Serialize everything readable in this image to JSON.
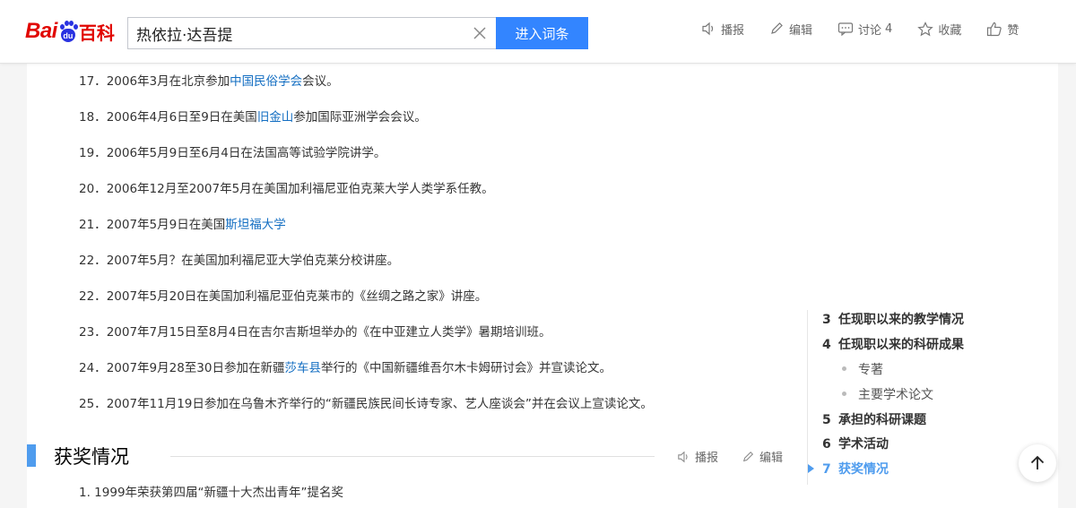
{
  "header": {
    "logo_bai": "Bai",
    "logo_du": "du",
    "logo_baike": "百科",
    "search_value": "热依拉·达吾提",
    "search_button": "进入词条",
    "tools": [
      {
        "label": "播报",
        "icon": "speaker-icon"
      },
      {
        "label": "编辑",
        "icon": "pencil-icon"
      },
      {
        "label": "讨论",
        "icon": "comment-icon",
        "count": "4"
      },
      {
        "label": "收藏",
        "icon": "star-icon"
      },
      {
        "label": "赞",
        "icon": "thumbs-up-icon"
      }
    ]
  },
  "activities": [
    {
      "num": "17．",
      "before": "2006年3月在北京参加",
      "link": "中国民俗学会",
      "after": "会议。"
    },
    {
      "num": "18．",
      "before": "2006年4月6日至9日在美国",
      "link": "旧金山",
      "after": "参加国际亚洲学会会议。"
    },
    {
      "num": "19．",
      "before": "2006年5月9日至6月4日在法国高等试验学院讲学。",
      "link": "",
      "after": ""
    },
    {
      "num": "20．",
      "before": "2006年12月至2007年5月在美国加利福尼亚伯克莱大学人类学系任教。",
      "link": "",
      "after": ""
    },
    {
      "num": "21．",
      "before": "2007年5月9日在美国",
      "link": "斯坦福大学",
      "after": ""
    },
    {
      "num": "22．",
      "before": "2007年5月？在美国加利福尼亚大学伯克莱分校讲座。",
      "link": "",
      "after": ""
    },
    {
      "num": "22．",
      "before": "2007年5月20日在美国加利福尼亚伯克莱市的《丝绸之路之家》讲座。",
      "link": "",
      "after": ""
    },
    {
      "num": "23．",
      "before": "2007年7月15日至8月4日在吉尔吉斯坦举办的《在中亚建立人类学》暑期培训班。",
      "link": "",
      "after": ""
    },
    {
      "num": "24．",
      "before": "2007年9月28至30日参加在新疆",
      "link": "莎车县",
      "after": "举行的《中国新疆维吾尔木卡姆研讨会》并宣读论文。"
    },
    {
      "num": "25．",
      "before": "2007年11月19日参加在乌鲁木齐举行的“新疆民族民间长诗专家、艺人座谈会”并在会议上宣读论文。",
      "link": "",
      "after": ""
    }
  ],
  "section": {
    "title": "获奖情况",
    "broadcast": "播报",
    "edit": "编辑"
  },
  "awards": [
    "1. 1999年荣获第四届“新疆十大杰出青年”提名奖"
  ],
  "toc": {
    "items": [
      {
        "num": "3",
        "label": "任现职以来的教学情况"
      },
      {
        "num": "4",
        "label": "任现职以来的科研成果"
      },
      {
        "num": "",
        "label": "专著"
      },
      {
        "num": "",
        "label": "主要学术论文"
      },
      {
        "num": "5",
        "label": "承担的科研课题"
      },
      {
        "num": "6",
        "label": "学术活动"
      },
      {
        "num": "7",
        "label": "获奖情况"
      }
    ],
    "active_index": 6,
    "accent_color": "#4f9cee"
  },
  "link_color": "#136ec2",
  "brand_red": "#e10601",
  "button_blue": "#3385ff"
}
